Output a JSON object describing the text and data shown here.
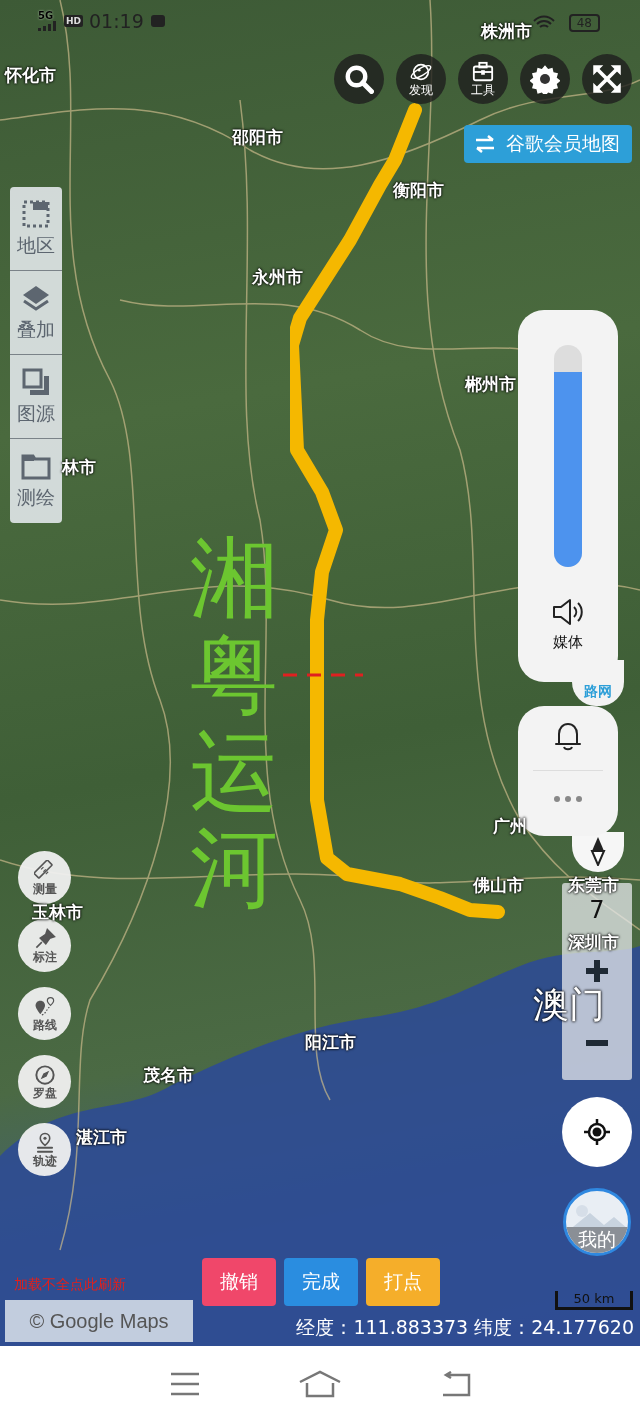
{
  "status_bar": {
    "network": "5G",
    "hd": "HD",
    "time": "01:19",
    "battery": "48"
  },
  "map_labels": [
    {
      "text": "怀化市",
      "kind": "city"
    },
    {
      "text": "株洲市",
      "kind": "city"
    },
    {
      "text": "邵阳市",
      "kind": "city"
    },
    {
      "text": "衡阳市",
      "kind": "city"
    },
    {
      "text": "永州市",
      "kind": "city"
    },
    {
      "text": "郴州市",
      "kind": "city"
    },
    {
      "text": "林市",
      "kind": "city"
    },
    {
      "text": "广州",
      "kind": "city"
    },
    {
      "text": "佛山市",
      "kind": "city"
    },
    {
      "text": "东莞市",
      "kind": "city"
    },
    {
      "text": "深圳市",
      "kind": "city"
    },
    {
      "text": "澳门",
      "kind": "region"
    },
    {
      "text": "玉林市",
      "kind": "city"
    },
    {
      "text": "阳江市",
      "kind": "city"
    },
    {
      "text": "茂名市",
      "kind": "city"
    },
    {
      "text": "湛江市",
      "kind": "city"
    }
  ],
  "annotation": {
    "text": "湘粤运河"
  },
  "top_buttons": [
    {
      "kind": "search"
    },
    {
      "kind": "discover",
      "label": "发现"
    },
    {
      "kind": "tools",
      "label": "工具"
    },
    {
      "kind": "settings"
    },
    {
      "kind": "fullscreen"
    }
  ],
  "member_map_button": {
    "label": "谷歌会员地图"
  },
  "sidebar": [
    {
      "kind": "region",
      "label": "地区"
    },
    {
      "kind": "overlay",
      "label": "叠加"
    },
    {
      "kind": "source",
      "label": "图源"
    },
    {
      "kind": "survey",
      "label": "测绘"
    }
  ],
  "volume": {
    "level": 0.88,
    "label": "媒体"
  },
  "road_network_button": {
    "label": "路网"
  },
  "zoom": {
    "value": "7"
  },
  "tools": [
    {
      "kind": "measure",
      "label": "测量"
    },
    {
      "kind": "mark",
      "label": "标注"
    },
    {
      "kind": "route",
      "label": "路线"
    },
    {
      "kind": "compass",
      "label": "罗盘"
    },
    {
      "kind": "track",
      "label": "轨迹"
    }
  ],
  "me_button": {
    "label": "我的"
  },
  "refresh_link": "加载不全点此刷新",
  "actions": [
    {
      "label": "撤销",
      "color": "#f0476a"
    },
    {
      "label": "完成",
      "color": "#2a8de0"
    },
    {
      "label": "打点",
      "color": "#f5ae2a"
    }
  ],
  "attribution": "© Google Maps",
  "scale": "50 km",
  "coordinates": "经度：111.883373 纬度：24.177620",
  "nav_bar": [
    {
      "kind": "menu"
    },
    {
      "kind": "home"
    },
    {
      "kind": "back"
    }
  ]
}
